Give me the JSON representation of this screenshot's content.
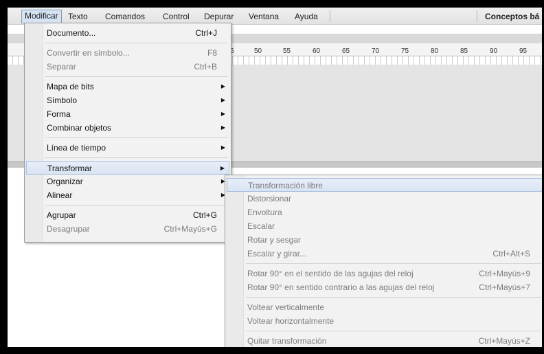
{
  "menubar": {
    "items": [
      "Modificar",
      "Texto",
      "Comandos",
      "Control",
      "Depurar",
      "Ventana",
      "Ayuda"
    ],
    "right_label": "Conceptos bá"
  },
  "ruler": {
    "ticks": [
      "5",
      "50",
      "55",
      "60",
      "65",
      "70",
      "75",
      "80",
      "85",
      "90",
      "95"
    ]
  },
  "modify_menu": [
    {
      "label": "Documento...",
      "shortcut": "Ctrl+J",
      "enabled": true
    },
    {
      "label": "Convertir en símbolo...",
      "shortcut": "F8",
      "enabled": false
    },
    {
      "label": "Separar",
      "shortcut": "Ctrl+B",
      "enabled": false
    },
    {
      "label": "Mapa de bits",
      "submenu": true,
      "enabled": true
    },
    {
      "label": "Símbolo",
      "submenu": true,
      "enabled": true
    },
    {
      "label": "Forma",
      "submenu": true,
      "enabled": true
    },
    {
      "label": "Combinar objetos",
      "submenu": true,
      "enabled": true
    },
    {
      "label": "Línea de tiempo",
      "submenu": true,
      "enabled": true
    },
    {
      "label": "Transformar",
      "submenu": true,
      "enabled": true,
      "highlighted": true
    },
    {
      "label": "Organizar",
      "submenu": true,
      "enabled": true
    },
    {
      "label": "Alinear",
      "submenu": true,
      "enabled": true
    },
    {
      "label": "Agrupar",
      "shortcut": "Ctrl+G",
      "enabled": true
    },
    {
      "label": "Desagrupar",
      "shortcut": "Ctrl+Mayús+G",
      "enabled": false
    }
  ],
  "transform_menu": [
    {
      "label": "Transformación libre",
      "enabled": false,
      "highlighted": true
    },
    {
      "label": "Distorsionar",
      "enabled": false
    },
    {
      "label": "Envoltura",
      "enabled": false
    },
    {
      "label": "Escalar",
      "enabled": false
    },
    {
      "label": "Rotar y sesgar",
      "enabled": false
    },
    {
      "label": "Escalar y girar...",
      "shortcut": "Ctrl+Alt+S",
      "enabled": false
    },
    {
      "label": "Rotar 90° en el sentido de las agujas del reloj",
      "shortcut": "Ctrl+Mayús+9",
      "enabled": false
    },
    {
      "label": "Rotar 90° en sentido contrario a las agujas del reloj",
      "shortcut": "Ctrl+Mayús+7",
      "enabled": false
    },
    {
      "label": "Voltear verticalmente",
      "enabled": false
    },
    {
      "label": "Voltear horizontalmente",
      "enabled": false
    },
    {
      "label": "Quitar transformación",
      "shortcut": "Ctrl+Mayús+Z",
      "enabled": false
    }
  ],
  "icons": {
    "submenu_arrow": "▶"
  }
}
